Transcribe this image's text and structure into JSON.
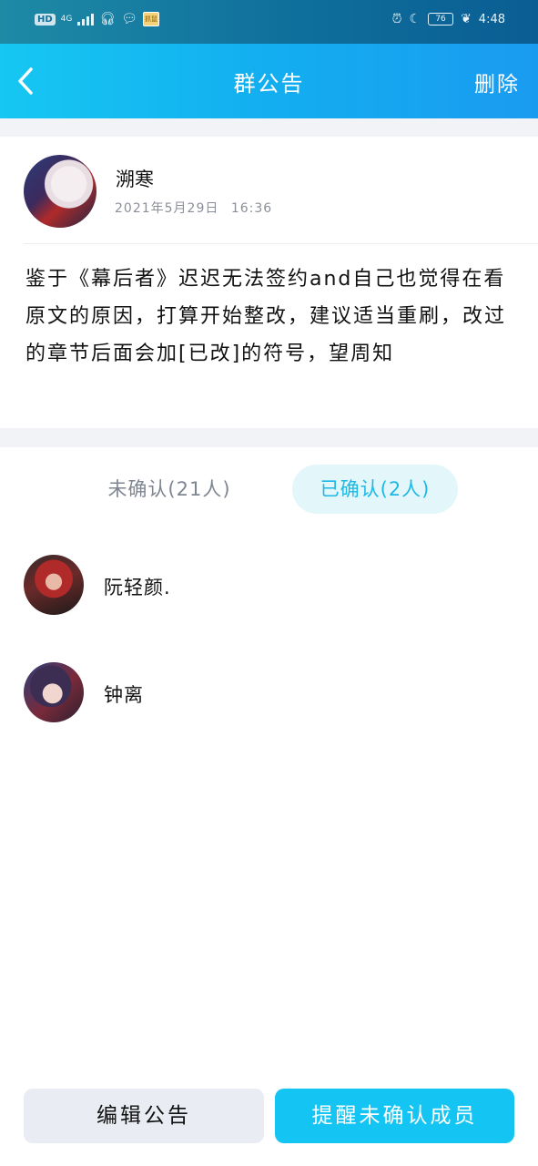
{
  "status_bar": {
    "hd": "HD",
    "network": "4G",
    "app_label": "抓鼠",
    "battery": "76",
    "time": "4:48"
  },
  "header": {
    "title": "群公告",
    "delete_label": "删除"
  },
  "notice": {
    "author": "溯寒",
    "date": "2021年5月29日",
    "time": "16:36",
    "content": "鉴于《幕后者》迟迟无法签约and自己也觉得在看原文的原因，打算开始整改，建议适当重刷，改过的章节后面会加[已改]的符号，望周知"
  },
  "tabs": {
    "unconfirmed": "未确认(21人)",
    "confirmed": "已确认(2人)",
    "active": "confirmed"
  },
  "members": [
    {
      "name": "阮轻颜."
    },
    {
      "name": "钟离"
    }
  ],
  "buttons": {
    "edit": "编辑公告",
    "remind": "提醒未确认成员"
  },
  "colors": {
    "accent": "#14c4f2",
    "header_gradient_start": "#16c7f2",
    "header_gradient_end": "#1a9bf0",
    "tab_active_bg": "#e3f7fb"
  }
}
